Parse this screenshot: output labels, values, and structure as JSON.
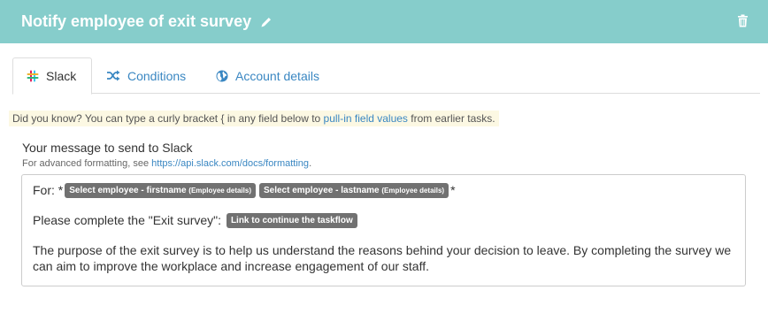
{
  "header": {
    "title": "Notify employee of exit survey",
    "bg_color": "#86cdcb"
  },
  "tabs": [
    {
      "label": "Slack",
      "icon": "slack-icon",
      "active": true
    },
    {
      "label": "Conditions",
      "icon": "shuffle-icon",
      "active": false
    },
    {
      "label": "Account details",
      "icon": "globe-icon",
      "active": false
    }
  ],
  "hint": {
    "prefix": "Did you know? You can type a curly bracket { in any field below to ",
    "link": "pull-in field values",
    "suffix": " from earlier tasks."
  },
  "message_field": {
    "label": "Your message to send to Slack",
    "help_prefix": "For advanced formatting, see ",
    "help_link": "https://api.slack.com/docs/formatting",
    "help_suffix": "."
  },
  "editor": {
    "line1_prefix": "For: *",
    "pill1_main": "Select employee - firstname",
    "pill1_sub": "(Employee details)",
    "pill2_main": "Select employee - lastname",
    "pill2_sub": "(Employee details)",
    "line1_suffix": "*",
    "line2_prefix": "Please complete the \"Exit survey\":",
    "pill3": "Link to continue the taskflow",
    "paragraph": "The purpose of the exit survey is to help us understand the reasons behind your decision to leave. By completing the survey we can aim to improve the workplace and increase engagement of our staff."
  }
}
